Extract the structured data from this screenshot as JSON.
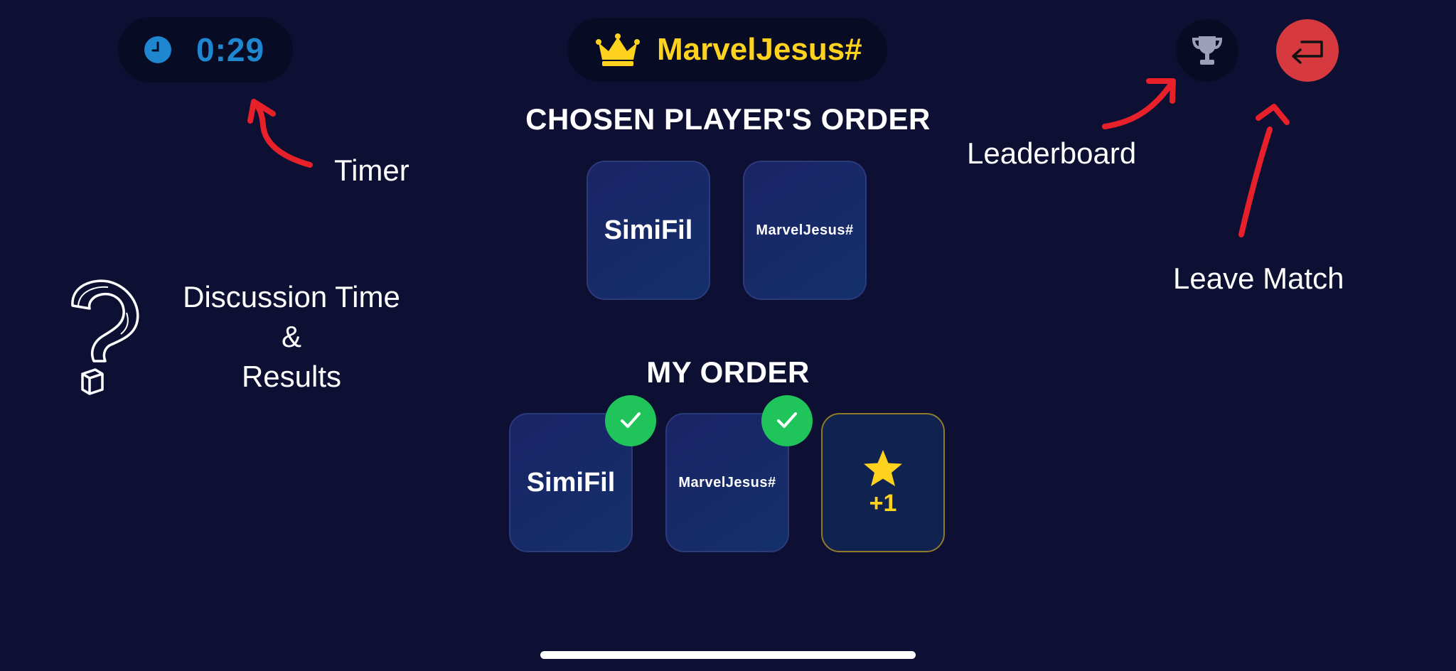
{
  "header": {
    "timer": "0:29",
    "player_name": "MarvelJesus#"
  },
  "icons": {
    "timer": "clock-icon",
    "player": "crown-icon",
    "leaderboard": "trophy-icon",
    "leave": "exit-arrow-icon",
    "correct": "checkmark-icon",
    "bonus": "star-icon"
  },
  "chosen_order": {
    "title": "CHOSEN PLAYER'S ORDER",
    "cards": [
      "SimiFil",
      "MarvelJesus#"
    ]
  },
  "my_order": {
    "title": "MY ORDER",
    "cards": [
      "SimiFil",
      "MarvelJesus#"
    ],
    "bonus": "+1"
  },
  "annotations": {
    "timer": "Timer",
    "leaderboard": "Leaderboard",
    "leave": "Leave Match",
    "discussion_line1": "Discussion Time",
    "discussion_line2": "&",
    "discussion_line3": "Results"
  },
  "colors": {
    "background": "#0d1033",
    "timer_text": "#1f86d0",
    "player_name": "#ffd21e",
    "leave_button": "#d63a3f",
    "check_badge": "#1fc55a",
    "annotation_arrow": "#e8202a"
  }
}
